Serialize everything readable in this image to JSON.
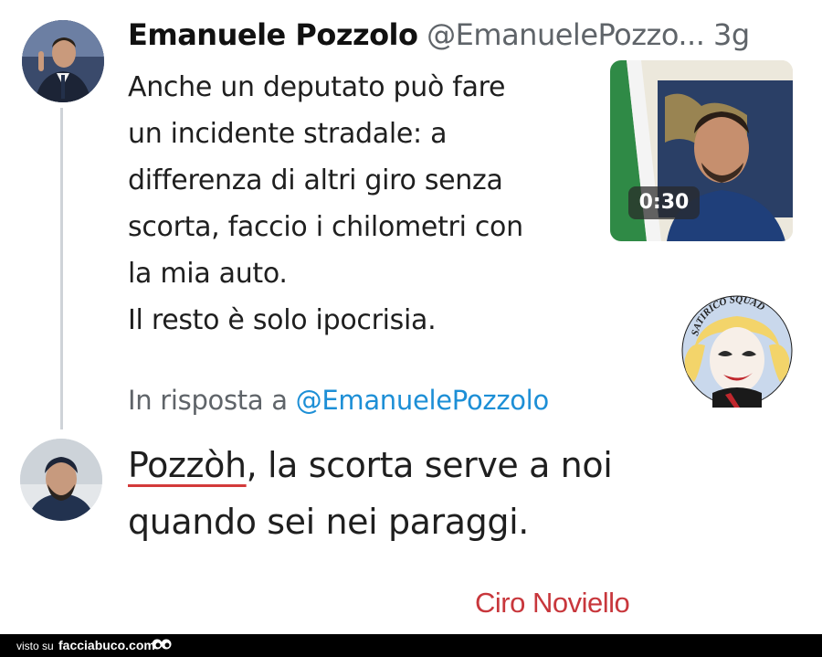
{
  "tweet": {
    "author_name": "Emanuele Pozzolo",
    "author_handle": "@EmanuelePozzo...",
    "time": "3g",
    "text_lines": [
      "Anche un deputato può fare",
      "un incidente stradale: a",
      "differenza di altri giro senza",
      "scorta, faccio i chilometri con",
      "la mia auto.",
      "Il resto è solo ipocrisia."
    ],
    "video_duration": "0:30"
  },
  "watermark": {
    "text": "SATIRICO SQUAD"
  },
  "reply": {
    "context_prefix": "In risposta a",
    "context_mention": "@EmanuelePozzolo",
    "first_word": "Pozzòh",
    "line1_rest": ", la scorta serve a noi",
    "line2": "quando sei nei paraggi."
  },
  "signature": "Ciro Noviello",
  "footer": {
    "prefix": "visto su",
    "site": "facciabuco.com"
  },
  "colors": {
    "mention": "#1d8fd6",
    "signature": "#c8373c",
    "underline": "#d33a3a",
    "footer_bg": "#000000"
  }
}
